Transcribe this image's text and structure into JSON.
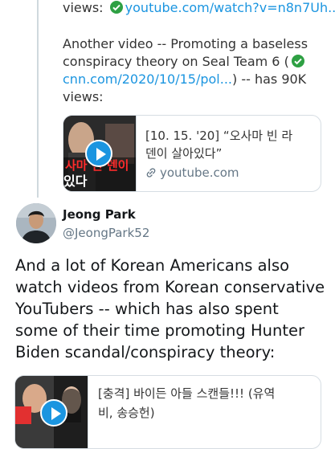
{
  "tweet1": {
    "line1_prefix": "views:",
    "line1_link": "youtube.com/watch?v=n8n7Uh...",
    "para2_line1": "Another video -- Promoting a baseless",
    "para2_line2_prefix": "conspiracy theory on Seal Team 6 (",
    "para2_line3_link": "cnn.com/2020/10/15/pol...",
    "para2_line3_suffix": ") -- has 90K",
    "para2_line4": "views:",
    "card": {
      "title_line1": "[10. 15. '20] “오사마 빈 라",
      "title_line2": "덴이 살아있다”",
      "domain": "youtube.com",
      "thumb_text": "사마 빈  덴이",
      "thumb_text2": "있다"
    }
  },
  "tweet2": {
    "name": "Jeong Park",
    "handle": "@JeongPark52",
    "body": [
      "And a lot of Korean Americans also",
      "watch videos from Korean conservative",
      "YouTubers -- which has also spent",
      "some of their time promoting Hunter",
      "Biden scandal/conspiracy theory:"
    ],
    "card": {
      "title_line1": "[충격] 바이든 아들 스캔들!!! (유역",
      "title_line2": "비, 송승헌)"
    }
  },
  "colors": {
    "link": "#1b95e0",
    "check": "#2ea043",
    "muted": "#657786"
  },
  "icons": [
    "check-icon",
    "play-icon",
    "link-icon"
  ]
}
